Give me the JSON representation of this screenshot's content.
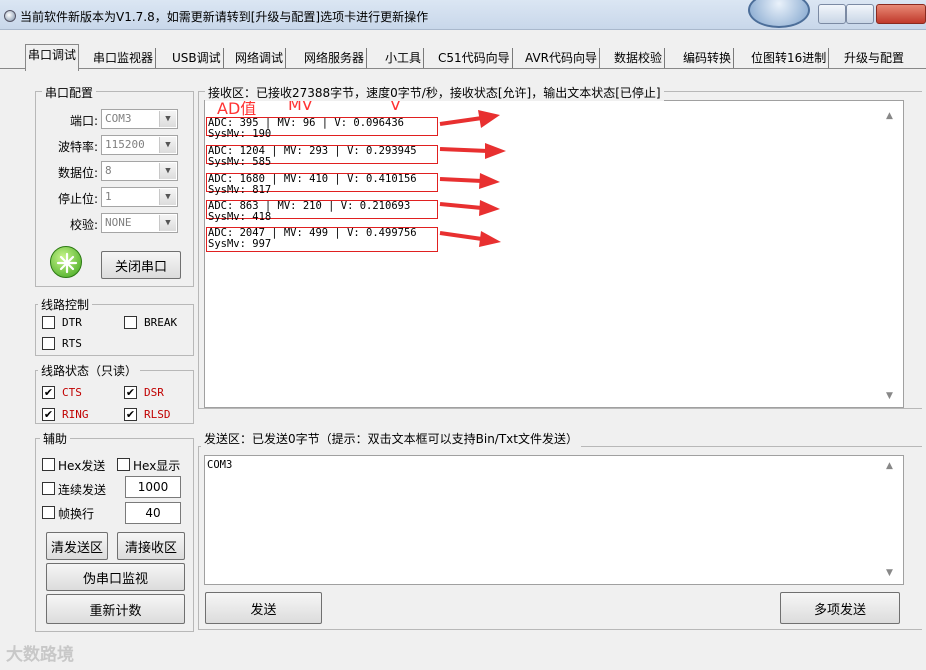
{
  "title_bar": {
    "title": "当前软件新版本为V1.7.8，如需更新请转到[升级与配置]选项卡进行更新操作",
    "icon": "app-icon"
  },
  "tabs": [
    {
      "label": "串口调试",
      "active": true
    },
    {
      "label": "串口监视器"
    },
    {
      "label": "USB调试"
    },
    {
      "label": "网络调试"
    },
    {
      "label": "网络服务器"
    },
    {
      "label": "小工具"
    },
    {
      "label": "C51代码向导"
    },
    {
      "label": "AVR代码向导"
    },
    {
      "label": "数据校验"
    },
    {
      "label": "编码转换"
    },
    {
      "label": "位图转16进制"
    },
    {
      "label": "升级与配置"
    }
  ],
  "serial_config": {
    "group_title": "串口配置",
    "port_label": "端口:",
    "port_value": "COM3",
    "baud_label": "波特率:",
    "baud_value": "115200",
    "databits_label": "数据位:",
    "databits_value": "8",
    "stopbits_label": "停止位:",
    "stopbits_value": "1",
    "parity_label": "校验:",
    "parity_value": "NONE",
    "close_port_button": "关闭串口"
  },
  "line_control": {
    "group_title": "线路控制",
    "dtr": {
      "label": "DTR",
      "checked": false
    },
    "break": {
      "label": "BREAK",
      "checked": false
    },
    "rts": {
      "label": "RTS",
      "checked": false
    }
  },
  "line_status": {
    "group_title": "线路状态（只读）",
    "cts": {
      "label": "CTS",
      "checked": true
    },
    "dsr": {
      "label": "DSR",
      "checked": true
    },
    "ring": {
      "label": "RING",
      "checked": true
    },
    "rlsd": {
      "label": "RLSD",
      "checked": true
    },
    "check_mark": "✔"
  },
  "aux": {
    "group_title": "辅助",
    "hex_send": {
      "label": "Hex发送",
      "checked": false
    },
    "hex_display": {
      "label": "Hex显示",
      "checked": false
    },
    "continuous_send": {
      "label": "连续发送",
      "checked": false,
      "value": "1000"
    },
    "frame_line": {
      "label": "帧换行",
      "checked": false,
      "value": "40"
    },
    "clear_send_button": "清发送区",
    "clear_receive_button": "清接收区",
    "pseudo_monitor_button": "伪串口监视",
    "recount_button": "重新计数"
  },
  "receive": {
    "group_title": "接收区：已接收27388字节，速度0字节/秒，接收状态[允许]，输出文本状态[已停止]",
    "annotations": {
      "adc": "AD值",
      "mv": "MV",
      "v": "V"
    },
    "lines": [
      "ADC: 395 | MV: 96 | V: 0.096436",
      "SysMv: 190",
      "ADC: 1204 | MV: 293 | V: 0.293945",
      "SysMv: 585",
      "ADC: 1680 | MV: 410 | V: 0.410156",
      "SysMv: 817",
      "ADC: 863 | MV: 210 | V: 0.210693",
      "SysMv: 418",
      "ADC: 2047 | MV: 499 | V: 0.499756",
      "SysMv: 997"
    ]
  },
  "send": {
    "group_title": "发送区：已发送0字节（提示：双击文本框可以支持Bin/Txt文件发送）",
    "content": "COM3",
    "send_button": "发送",
    "multi_send_button": "多项发送"
  },
  "scroll": {
    "up": "▲",
    "down": "▼"
  },
  "dropdown_arrow": "▼",
  "watermark": "大数路境",
  "colors": {
    "accent_red": "#e02020",
    "status_red": "#c00000"
  }
}
